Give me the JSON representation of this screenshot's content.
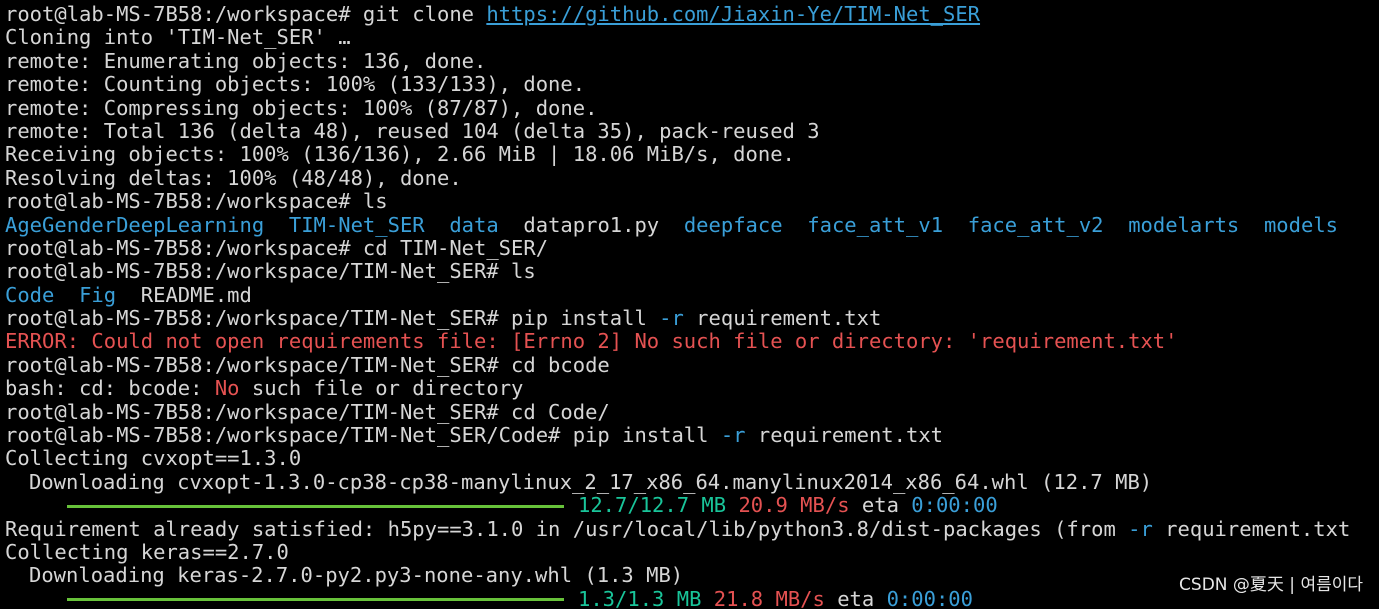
{
  "terminal": {
    "background": "#000000",
    "colors": {
      "text": "#d6d6d6",
      "directory": "#3a9fd8",
      "error": "#e55252",
      "progress": "#19c59a",
      "progress_bar": "#67c23a"
    },
    "lines": [
      {
        "segments": [
          {
            "text": "root@lab-MS-7B58:/workspace# git clone "
          },
          {
            "text": "https://github.com/Jiaxin-Ye/TIM-Net_SER",
            "style": "link"
          }
        ]
      },
      {
        "segments": [
          {
            "text": "Cloning into 'TIM-Net_SER' …"
          }
        ]
      },
      {
        "segments": [
          {
            "text": "remote: Enumerating objects: 136, done."
          }
        ]
      },
      {
        "segments": [
          {
            "text": "remote: Counting objects: 100% (133/133), done."
          }
        ]
      },
      {
        "segments": [
          {
            "text": "remote: Compressing objects: 100% (87/87), done."
          }
        ]
      },
      {
        "segments": [
          {
            "text": "remote: Total 136 (delta 48), reused 104 (delta 35), pack-reused 3"
          }
        ]
      },
      {
        "segments": [
          {
            "text": "Receiving objects: 100% (136/136), 2.66 MiB | 18.06 MiB/s, done."
          }
        ]
      },
      {
        "segments": [
          {
            "text": "Resolving deltas: 100% (48/48), done."
          }
        ]
      },
      {
        "segments": [
          {
            "text": "root@lab-MS-7B58:/workspace# ls"
          }
        ]
      },
      {
        "segments": [
          {
            "text": "AgeGenderDeepLearning",
            "style": "cyan"
          },
          {
            "text": "  "
          },
          {
            "text": "TIM-Net_SER",
            "style": "cyan"
          },
          {
            "text": "  "
          },
          {
            "text": "data",
            "style": "cyan"
          },
          {
            "text": "  "
          },
          {
            "text": "datapro1.py"
          },
          {
            "text": "  "
          },
          {
            "text": "deepface",
            "style": "cyan"
          },
          {
            "text": "  "
          },
          {
            "text": "face_att_v1",
            "style": "cyan"
          },
          {
            "text": "  "
          },
          {
            "text": "face_att_v2",
            "style": "cyan"
          },
          {
            "text": "  "
          },
          {
            "text": "modelarts",
            "style": "cyan"
          },
          {
            "text": "  "
          },
          {
            "text": "models",
            "style": "cyan"
          }
        ]
      },
      {
        "segments": [
          {
            "text": "root@lab-MS-7B58:/workspace# cd TIM-Net_SER/"
          }
        ]
      },
      {
        "segments": [
          {
            "text": "root@lab-MS-7B58:/workspace/TIM-Net_SER# ls"
          }
        ]
      },
      {
        "segments": [
          {
            "text": "Code",
            "style": "cyan"
          },
          {
            "text": "  "
          },
          {
            "text": "Fig",
            "style": "cyan"
          },
          {
            "text": "  "
          },
          {
            "text": "README.md"
          }
        ]
      },
      {
        "segments": [
          {
            "text": "root@lab-MS-7B58:/workspace/TIM-Net_SER# pip install "
          },
          {
            "text": "-r",
            "style": "cyan"
          },
          {
            "text": " requirement.txt"
          }
        ]
      },
      {
        "segments": [
          {
            "text": "ERROR: Could not open requirements file: [Errno 2] No such file or directory: 'requirement.txt'",
            "style": "red"
          }
        ]
      },
      {
        "segments": [
          {
            "text": "root@lab-MS-7B58:/workspace/TIM-Net_SER# cd bcode"
          }
        ]
      },
      {
        "segments": [
          {
            "text": "bash: cd: bcode: "
          },
          {
            "text": "No",
            "style": "red"
          },
          {
            "text": " such file or directory"
          }
        ]
      },
      {
        "segments": [
          {
            "text": "root@lab-MS-7B58:/workspace/TIM-Net_SER# cd Code/"
          }
        ]
      },
      {
        "segments": [
          {
            "text": "root@lab-MS-7B58:/workspace/TIM-Net_SER/Code# pip install "
          },
          {
            "text": "-r",
            "style": "cyan"
          },
          {
            "text": " requirement.txt"
          }
        ]
      },
      {
        "segments": [
          {
            "text": "Collecting cvxopt==1.3.0"
          }
        ]
      },
      {
        "indent": true,
        "segments": [
          {
            "text": "Downloading cvxopt-1.3.0-cp38-cp38-manylinux_2_17_x86_64.manylinux2014_x86_64.whl (12.7 MB)"
          }
        ]
      },
      {
        "progress": 1.0,
        "segments": [
          {
            "text": "12.7/12.7 MB",
            "style": "green"
          },
          {
            "text": " "
          },
          {
            "text": "20.9 MB/s",
            "style": "red"
          },
          {
            "text": " eta "
          },
          {
            "text": "0:00:00",
            "style": "cyan"
          }
        ]
      },
      {
        "segments": [
          {
            "text": "Requirement already satisfied: h5py==3.1.0 in /usr/local/lib/python3.8/dist-packages (from "
          },
          {
            "text": "-r",
            "style": "cyan"
          },
          {
            "text": " requirement.txt"
          }
        ]
      },
      {
        "segments": [
          {
            "text": "Collecting keras==2.7.0"
          }
        ]
      },
      {
        "indent": true,
        "segments": [
          {
            "text": "Downloading keras-2.7.0-py2.py3-none-any.whl (1.3 MB)"
          }
        ]
      },
      {
        "progress": 1.0,
        "segments": [
          {
            "text": "1.3/1.3 MB",
            "style": "green"
          },
          {
            "text": " "
          },
          {
            "text": "21.8 MB/s",
            "style": "red"
          },
          {
            "text": " eta "
          },
          {
            "text": "0:00:00",
            "style": "cyan"
          }
        ]
      }
    ]
  },
  "watermark": {
    "text": "CSDN @夏天 | 여름이다"
  }
}
